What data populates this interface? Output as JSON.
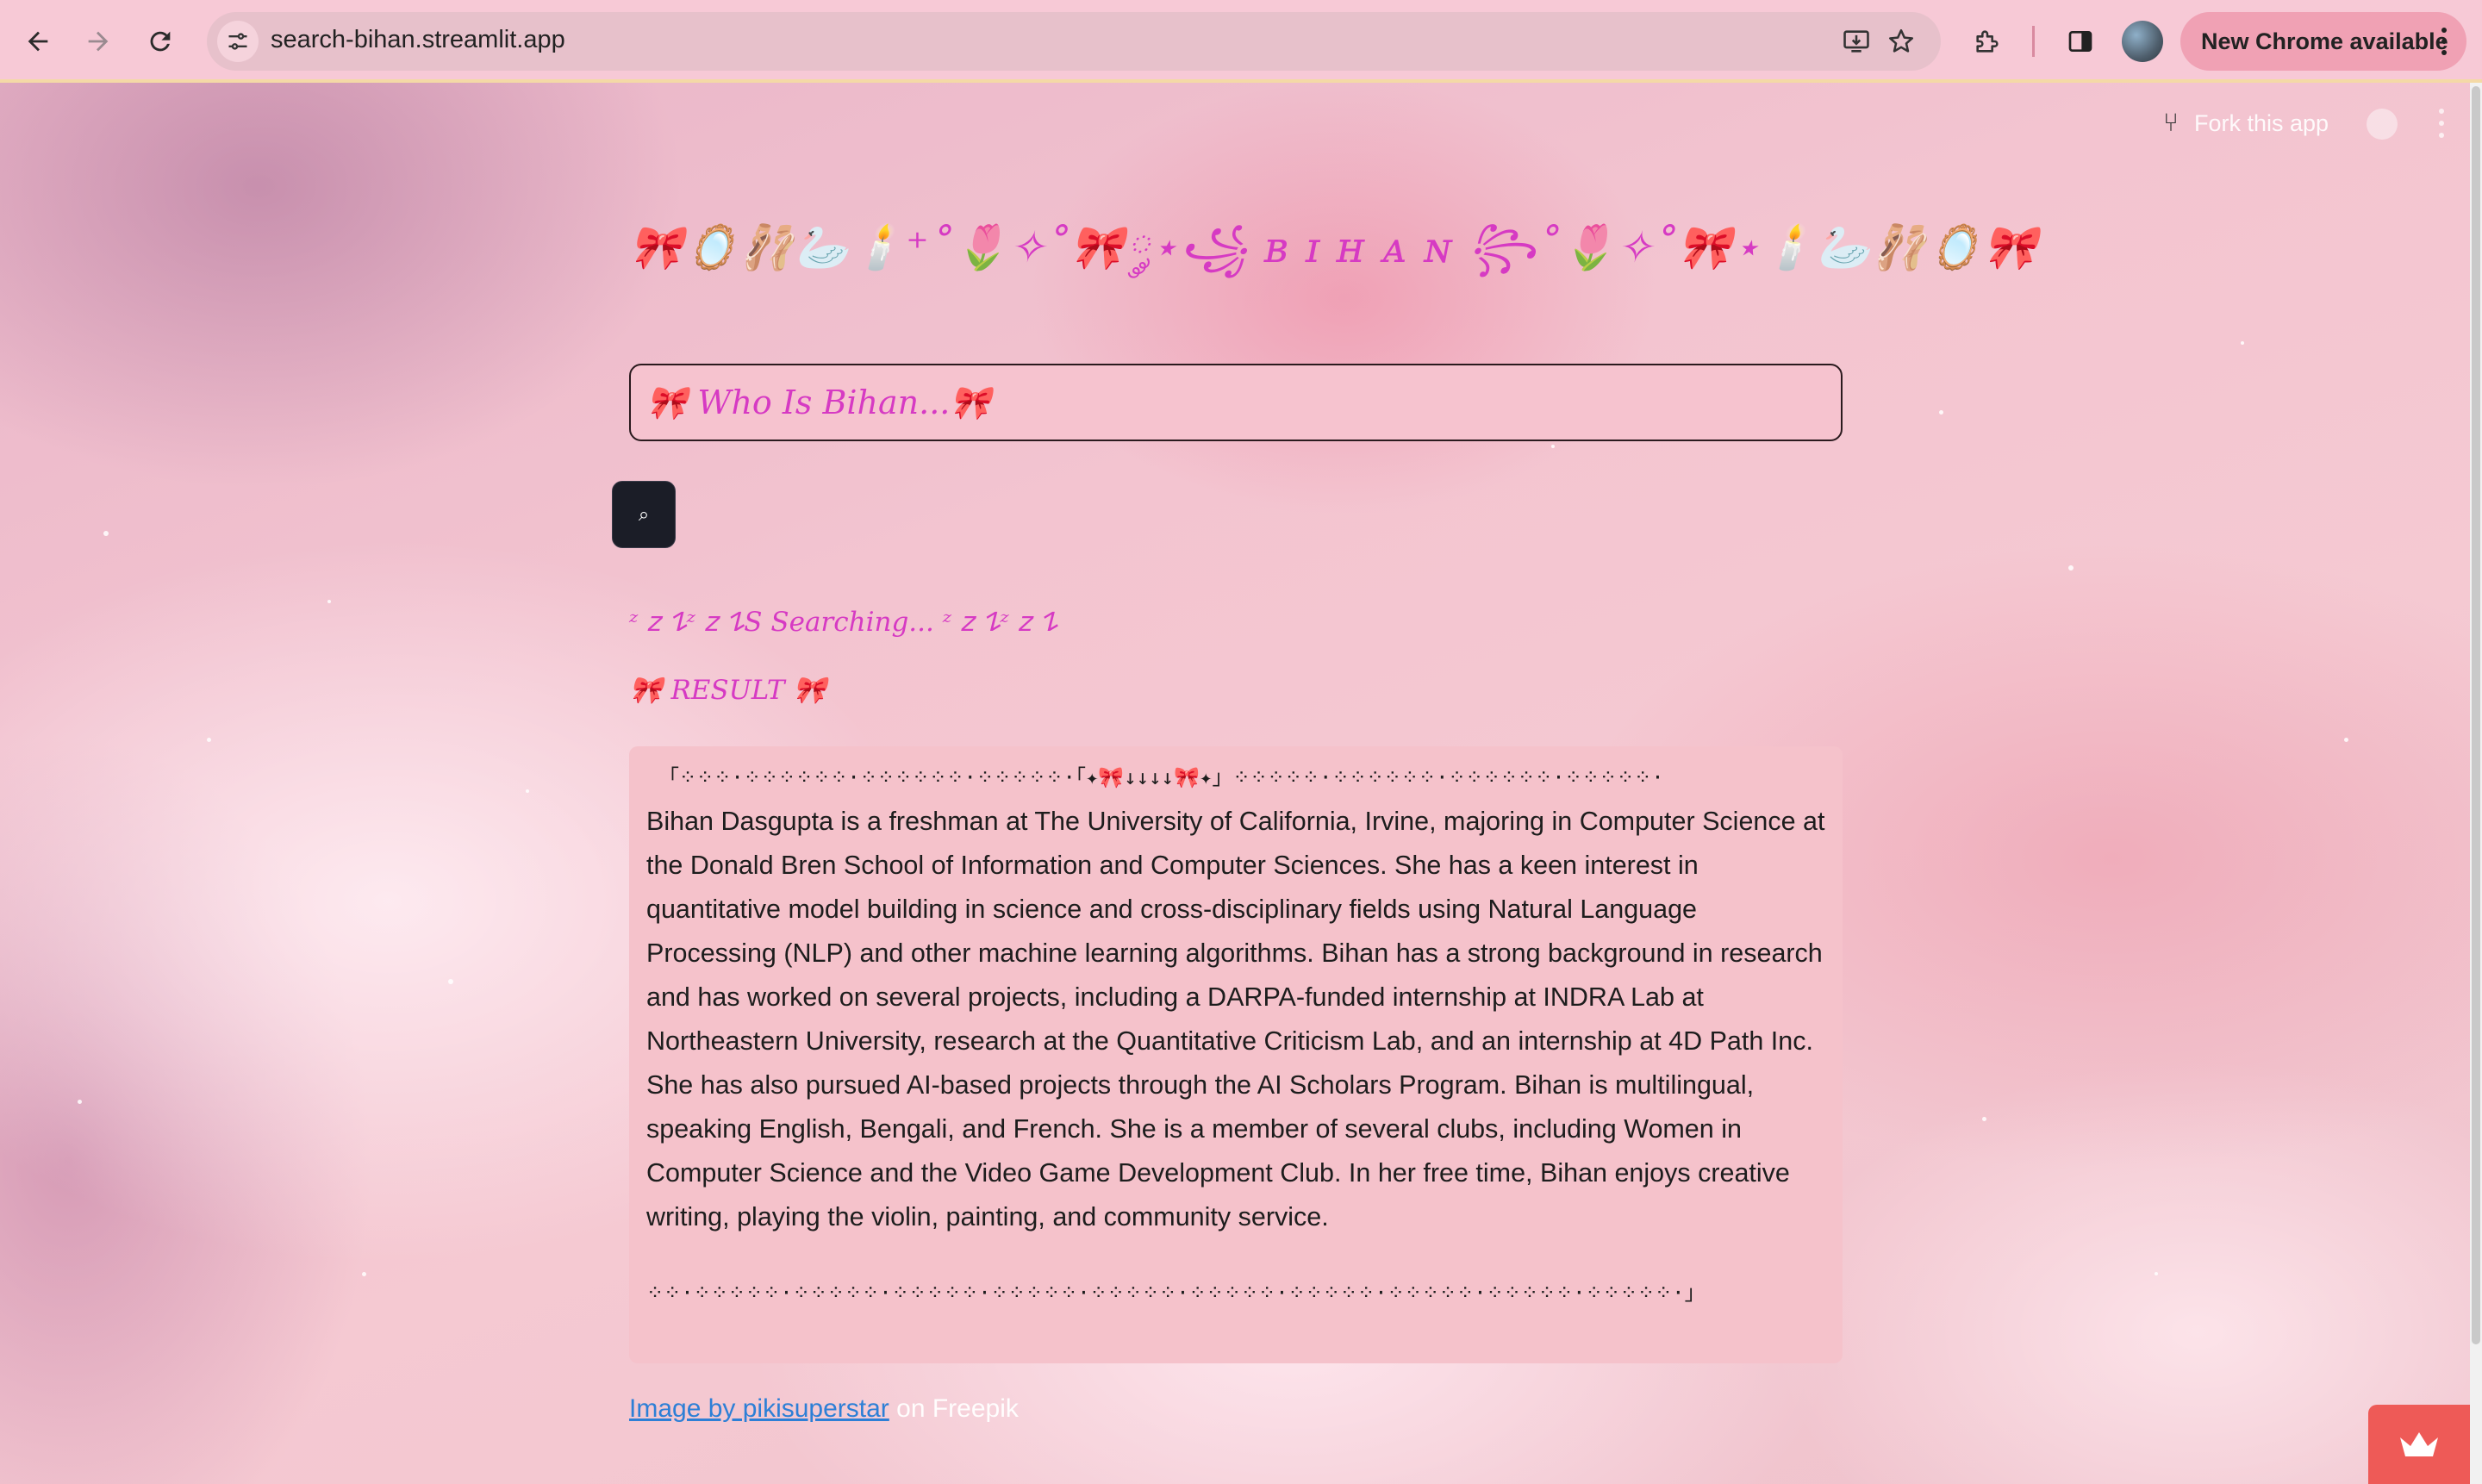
{
  "browser": {
    "url": "search-bihan.streamlit.app",
    "update_button": "New Chrome available"
  },
  "streamlit_header": {
    "fork_label": "Fork this app"
  },
  "app": {
    "title": "🎀🪞🩰🦢🕯️⁺˚🌷✧˚🎀༘⋆꧁ ʙ ɪ ʜ ᴀ ɴ ꧂˚🌷✧˚🎀⋆🕯️🦢🩰🪞🎀",
    "input_value": "🎀 Who Is Bihan...🎀",
    "input_placeholder": "",
    "search_button": "⌕",
    "status": "ᶻ 𝗓 𐰁ᶻ 𝗓 𐰁S Searching... ᶻ 𝗓 𐰁ᶻ 𝗓 𐰁",
    "result_heading": "🎀 RESULT 🎀",
    "result_top_frame": "「⁘⁘⁘·⁘⁘⁘⁘⁘⁘·⁘⁘⁘⁘⁘⁘·⁘⁘⁘⁘⁘·「✦🎀↓↓↓↓🎀✦」⁘⁘⁘⁘⁘·⁘⁘⁘⁘⁘⁘·⁘⁘⁘⁘⁘⁘·⁘⁘⁘⁘⁘·",
    "result_body": "Bihan Dasgupta is a freshman at The University of California, Irvine, majoring in Computer Science at the Donald Bren School of Information and Computer Sciences. She has a keen interest in quantitative model building in science and cross-disciplinary fields using Natural Language Processing (NLP) and other machine learning algorithms. Bihan has a strong background in research and has worked on several projects, including a DARPA-funded internship at INDRA Lab at Northeastern University, research at the Quantitative Criticism Lab, and an internship at 4D Path Inc. She has also pursued AI-based projects through the AI Scholars Program. Bihan is multilingual, speaking English, Bengali, and French. She is a member of several clubs, including Women in Computer Science and the Video Game Development Club. In her free time, Bihan enjoys creative writing, playing the violin, painting, and community service.",
    "result_bottom_frame": "⁘⁘·⁘⁘⁘⁘⁘·⁘⁘⁘⁘⁘·⁘⁘⁘⁘⁘·⁘⁘⁘⁘⁘·⁘⁘⁘⁘⁘·⁘⁘⁘⁘⁘·⁘⁘⁘⁘⁘·⁘⁘⁘⁘⁘·⁘⁘⁘⁘⁘·⁘⁘⁘⁘⁘·」",
    "credit_link": "Image by pikisuperstar",
    "credit_rest": " on Freepik"
  },
  "icons": {
    "back": "arrow-left-icon",
    "forward": "arrow-right-icon",
    "reload": "reload-icon",
    "site_info": "tune-icon",
    "install": "install-app-icon",
    "bookmark": "star-icon",
    "extensions": "puzzle-icon",
    "side_panel": "side-panel-icon",
    "profile": "avatar",
    "fork": "fork-icon",
    "github": "github-icon",
    "streamlit": "crown-icon"
  },
  "colors": {
    "chrome_bg": "#f7c9d6",
    "accent_text": "#d63ac3",
    "card_bg": "#f5c2cb",
    "button_bg": "#1b1d27",
    "link": "#2d7fd6",
    "badge": "#ee5a57"
  }
}
